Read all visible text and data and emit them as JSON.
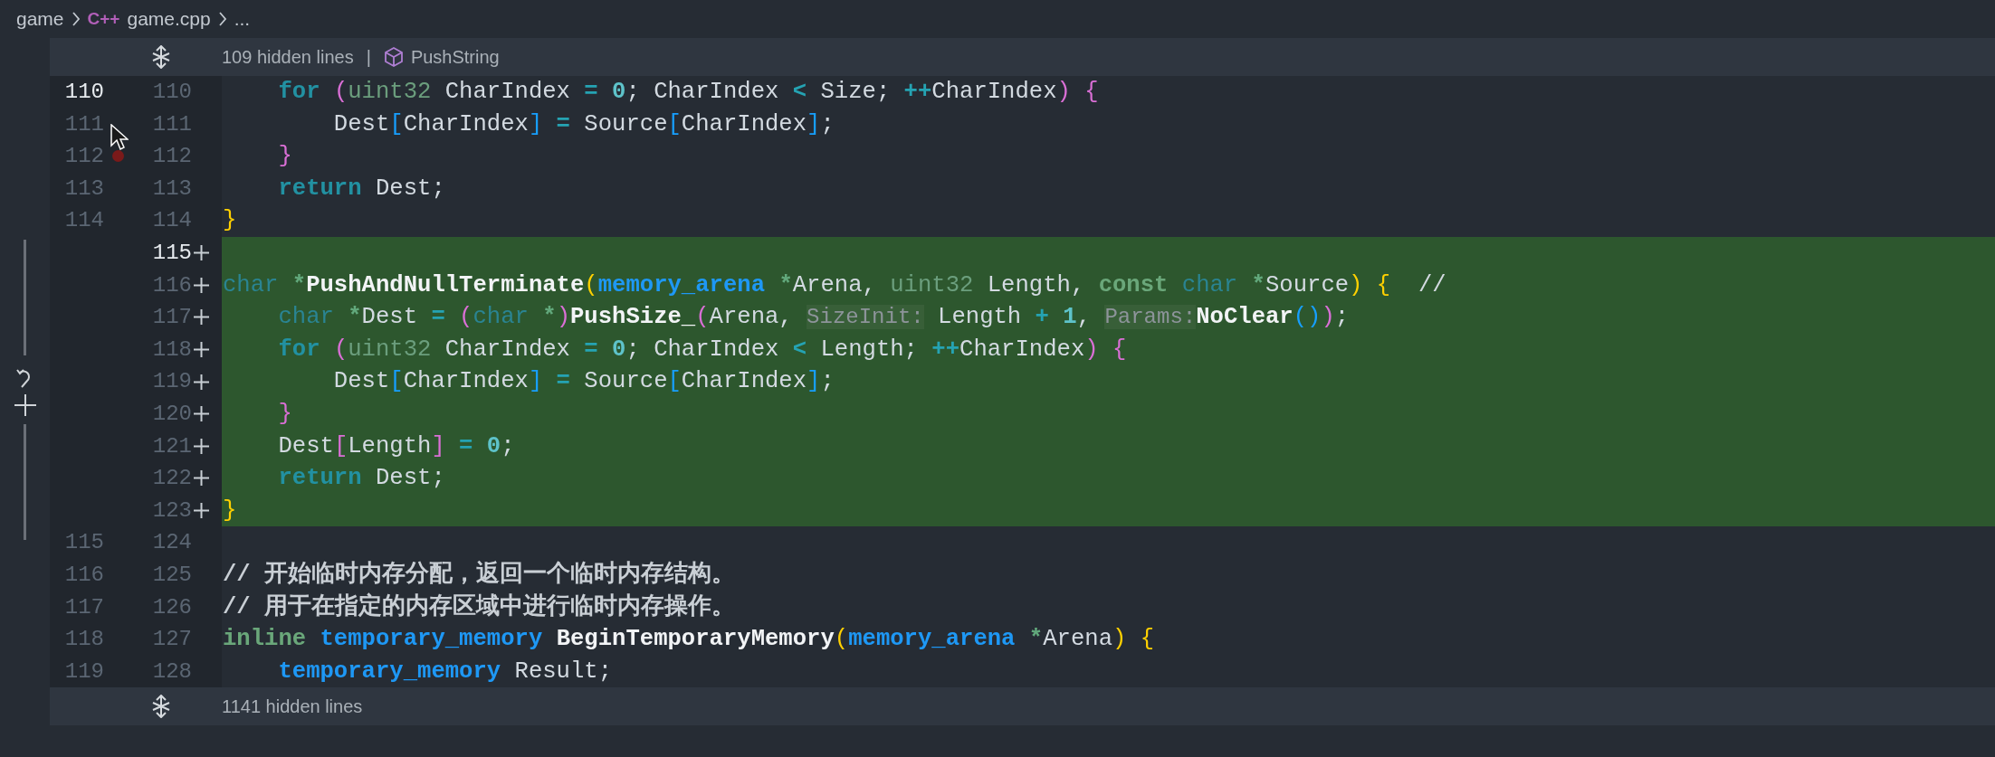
{
  "breadcrumb": {
    "folder": "game",
    "lang_badge": "C++",
    "file": "game.cpp",
    "more": "..."
  },
  "blocks": [
    {
      "kind": "fold",
      "text": "109 hidden lines",
      "separator": "|",
      "symbol": "PushString"
    },
    {
      "kind": "rows",
      "rows": [
        {
          "old": "110",
          "new": "110",
          "added": false,
          "old_current": true,
          "new_current": false,
          "breakpoint": false,
          "tokens": [
            {
              "kind": "kw",
              "text": "    for "
            },
            {
              "kind": "b2",
              "text": "("
            },
            {
              "kind": "prim",
              "text": "uint32"
            },
            {
              "kind": "id",
              "text": " CharIndex "
            },
            {
              "kind": "op",
              "text": "= "
            },
            {
              "kind": "num",
              "text": "0"
            },
            {
              "kind": "id",
              "text": "; CharIndex "
            },
            {
              "kind": "op",
              "text": "<"
            },
            {
              "kind": "id",
              "text": " Size; "
            },
            {
              "kind": "op",
              "text": "++"
            },
            {
              "kind": "id",
              "text": "CharIndex"
            },
            {
              "kind": "b2",
              "text": ")"
            },
            {
              "kind": "b2",
              "text": " {"
            }
          ]
        },
        {
          "old": "111",
          "new": "111",
          "added": false,
          "old_current": false,
          "new_current": false,
          "breakpoint": false,
          "tokens": [
            {
              "kind": "id",
              "text": "        Dest"
            },
            {
              "kind": "b3",
              "text": "["
            },
            {
              "kind": "id",
              "text": "CharIndex"
            },
            {
              "kind": "b3",
              "text": "]"
            },
            {
              "kind": "op",
              "text": " ="
            },
            {
              "kind": "id",
              "text": " Source"
            },
            {
              "kind": "b3",
              "text": "["
            },
            {
              "kind": "id",
              "text": "CharIndex"
            },
            {
              "kind": "b3",
              "text": "]"
            },
            {
              "kind": "id",
              "text": ";"
            }
          ]
        },
        {
          "old": "112",
          "new": "112",
          "added": false,
          "old_current": false,
          "new_current": false,
          "breakpoint": true,
          "tokens": [
            {
              "kind": "b2",
              "text": "    }"
            }
          ]
        },
        {
          "old": "113",
          "new": "113",
          "added": false,
          "old_current": false,
          "new_current": false,
          "breakpoint": false,
          "tokens": [
            {
              "kind": "kw",
              "text": "    return"
            },
            {
              "kind": "id",
              "text": " Dest;"
            }
          ]
        },
        {
          "old": "114",
          "new": "114",
          "added": false,
          "old_current": false,
          "new_current": false,
          "breakpoint": false,
          "tokens": [
            {
              "kind": "b1",
              "text": "}"
            }
          ]
        },
        {
          "new": "115",
          "added": true,
          "new_current": true
        },
        {
          "new": "116",
          "added": true,
          "new_current": false,
          "tokens": [
            {
              "kind": "ty",
              "text": "char "
            },
            {
              "kind": "ptr",
              "text": "*"
            },
            {
              "kind": "fn",
              "text": "PushAndNullTerminate"
            },
            {
              "kind": "b1",
              "text": "("
            },
            {
              "kind": "st",
              "text": "memory_arena "
            },
            {
              "kind": "ptr",
              "text": "*"
            },
            {
              "kind": "id",
              "text": "Arena, "
            },
            {
              "kind": "prim",
              "text": "uint32"
            },
            {
              "kind": "id",
              "text": " Length, "
            },
            {
              "kind": "mod",
              "text": "const "
            },
            {
              "kind": "ty",
              "text": "char "
            },
            {
              "kind": "ptr",
              "text": "*"
            },
            {
              "kind": "id",
              "text": "Source"
            },
            {
              "kind": "b1",
              "text": ")"
            },
            {
              "kind": "b1",
              "text": " {"
            },
            {
              "kind": "id",
              "text": "  //"
            }
          ]
        },
        {
          "new": "117",
          "added": true,
          "new_current": false,
          "tokens": [
            {
              "kind": "ty",
              "text": "    char "
            },
            {
              "kind": "ptr",
              "text": "*"
            },
            {
              "kind": "id",
              "text": "Dest "
            },
            {
              "kind": "op",
              "text": "= "
            },
            {
              "kind": "b2",
              "text": "("
            },
            {
              "kind": "ty",
              "text": "char "
            },
            {
              "kind": "ptr",
              "text": "*"
            },
            {
              "kind": "b2",
              "text": ")"
            },
            {
              "kind": "fn",
              "text": "PushSize_"
            },
            {
              "kind": "b2",
              "text": "("
            },
            {
              "kind": "id",
              "text": "Arena, "
            },
            {
              "kind": "hint",
              "text": "SizeInit:"
            },
            {
              "kind": "id",
              "text": " Length "
            },
            {
              "kind": "op",
              "text": "+ "
            },
            {
              "kind": "num",
              "text": "1"
            },
            {
              "kind": "id",
              "text": ", "
            },
            {
              "kind": "hint",
              "text": "Params:"
            },
            {
              "kind": "fn",
              "text": "NoClear"
            },
            {
              "kind": "b3",
              "text": "("
            },
            {
              "kind": "b3",
              "text": ")"
            },
            {
              "kind": "b2",
              "text": ")"
            },
            {
              "kind": "id",
              "text": ";"
            }
          ]
        },
        {
          "new": "118",
          "added": true,
          "new_current": false,
          "tokens": [
            {
              "kind": "kw",
              "text": "    for "
            },
            {
              "kind": "b2",
              "text": "("
            },
            {
              "kind": "prim",
              "text": "uint32"
            },
            {
              "kind": "id",
              "text": " CharIndex "
            },
            {
              "kind": "op",
              "text": "= "
            },
            {
              "kind": "num",
              "text": "0"
            },
            {
              "kind": "id",
              "text": "; CharIndex "
            },
            {
              "kind": "op",
              "text": "<"
            },
            {
              "kind": "id",
              "text": " Length; "
            },
            {
              "kind": "op",
              "text": "++"
            },
            {
              "kind": "id",
              "text": "CharIndex"
            },
            {
              "kind": "b2",
              "text": ")"
            },
            {
              "kind": "b2",
              "text": " {"
            }
          ]
        },
        {
          "new": "119",
          "added": true,
          "new_current": false,
          "tokens": [
            {
              "kind": "id",
              "text": "        Dest"
            },
            {
              "kind": "b3",
              "text": "["
            },
            {
              "kind": "id",
              "text": "CharIndex"
            },
            {
              "kind": "b3",
              "text": "]"
            },
            {
              "kind": "op",
              "text": " ="
            },
            {
              "kind": "id",
              "text": " Source"
            },
            {
              "kind": "b3",
              "text": "["
            },
            {
              "kind": "id",
              "text": "CharIndex"
            },
            {
              "kind": "b3",
              "text": "]"
            },
            {
              "kind": "id",
              "text": ";"
            }
          ]
        },
        {
          "new": "120",
          "added": true,
          "new_current": false,
          "tokens": [
            {
              "kind": "b2",
              "text": "    }"
            }
          ]
        },
        {
          "new": "121",
          "added": true,
          "new_current": false,
          "tokens": [
            {
              "kind": "id",
              "text": "    Dest"
            },
            {
              "kind": "b2",
              "text": "["
            },
            {
              "kind": "id",
              "text": "Length"
            },
            {
              "kind": "b2",
              "text": "]"
            },
            {
              "kind": "op",
              "text": " = "
            },
            {
              "kind": "num",
              "text": "0"
            },
            {
              "kind": "id",
              "text": ";"
            }
          ]
        },
        {
          "new": "122",
          "added": true,
          "new_current": false,
          "tokens": [
            {
              "kind": "kw",
              "text": "    return"
            },
            {
              "kind": "id",
              "text": " Dest;"
            }
          ]
        },
        {
          "new": "123",
          "added": true,
          "new_current": false,
          "tokens": [
            {
              "kind": "b1",
              "text": "}"
            }
          ]
        },
        {
          "old": "115",
          "new": "124",
          "added": false,
          "old_current": false,
          "new_current": false,
          "breakpoint": false
        },
        {
          "old": "116",
          "new": "125",
          "added": false,
          "old_current": false,
          "new_current": false,
          "breakpoint": false,
          "tokens": [
            {
              "kind": "cm",
              "text": "// 开始临时内存分配，返回一个临时内存结构。"
            }
          ]
        },
        {
          "old": "117",
          "new": "126",
          "added": false,
          "old_current": false,
          "new_current": false,
          "breakpoint": false,
          "tokens": [
            {
              "kind": "cm",
              "text": "// 用于在指定的内存区域中进行临时内存操作。"
            }
          ]
        },
        {
          "old": "118",
          "new": "127",
          "added": false,
          "old_current": false,
          "new_current": false,
          "breakpoint": false,
          "tokens": [
            {
              "kind": "mod",
              "text": "inline "
            },
            {
              "kind": "st",
              "text": "temporary_memory "
            },
            {
              "kind": "fn",
              "text": "BeginTemporaryMemory"
            },
            {
              "kind": "b1",
              "text": "("
            },
            {
              "kind": "st",
              "text": "memory_arena "
            },
            {
              "kind": "ptr",
              "text": "*"
            },
            {
              "kind": "id",
              "text": "Arena"
            },
            {
              "kind": "b1",
              "text": ")"
            },
            {
              "kind": "b1",
              "text": " {"
            }
          ]
        },
        {
          "old": "119",
          "new": "128",
          "added": false,
          "old_current": false,
          "new_current": false,
          "breakpoint": false,
          "tokens": [
            {
              "kind": "st",
              "text": "    temporary_memory"
            },
            {
              "kind": "id",
              "text": " Result;"
            }
          ]
        }
      ]
    },
    {
      "kind": "fold",
      "text": "1141 hidden lines"
    }
  ]
}
